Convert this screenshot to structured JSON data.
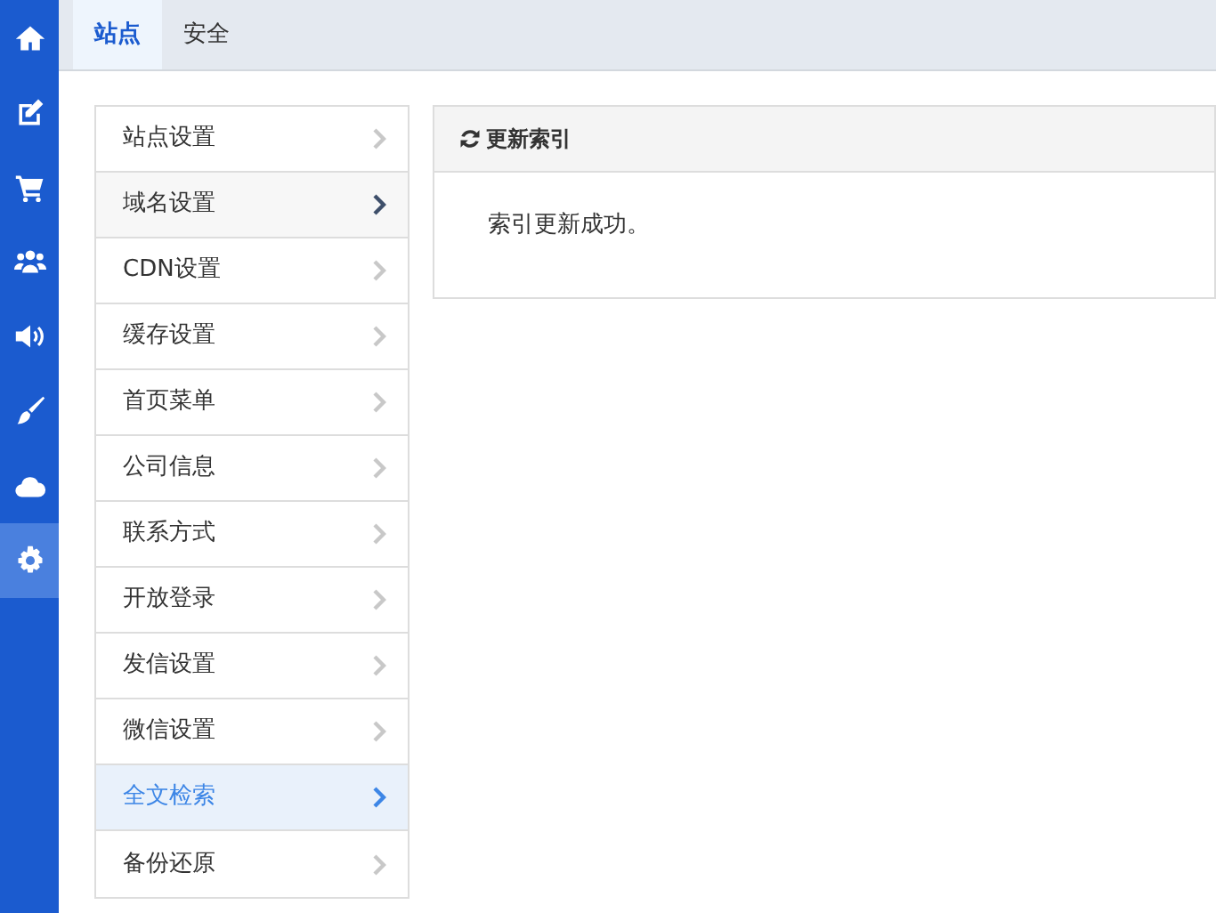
{
  "sidebar": {
    "items": [
      {
        "selected": false
      },
      {
        "selected": false
      },
      {
        "selected": false
      },
      {
        "selected": false
      },
      {
        "selected": false
      },
      {
        "selected": false
      },
      {
        "selected": false
      },
      {
        "selected": true
      }
    ]
  },
  "tabs": [
    {
      "label": "站点",
      "selected": true
    },
    {
      "label": "安全",
      "selected": false
    }
  ],
  "menu": [
    {
      "label": "站点设置",
      "selected": false,
      "hovered": false
    },
    {
      "label": "域名设置",
      "selected": false,
      "hovered": true
    },
    {
      "label": "CDN设置",
      "selected": false,
      "hovered": false
    },
    {
      "label": "缓存设置",
      "selected": false,
      "hovered": false
    },
    {
      "label": "首页菜单",
      "selected": false,
      "hovered": false
    },
    {
      "label": "公司信息",
      "selected": false,
      "hovered": false
    },
    {
      "label": "联系方式",
      "selected": false,
      "hovered": false
    },
    {
      "label": "开放登录",
      "selected": false,
      "hovered": false
    },
    {
      "label": "发信设置",
      "selected": false,
      "hovered": false
    },
    {
      "label": "微信设置",
      "selected": false,
      "hovered": false
    },
    {
      "label": "全文检索",
      "selected": true,
      "hovered": false
    },
    {
      "label": "备份还原",
      "selected": false,
      "hovered": false
    }
  ],
  "panel": {
    "title": "更新索引",
    "message": "索引更新成功。"
  }
}
